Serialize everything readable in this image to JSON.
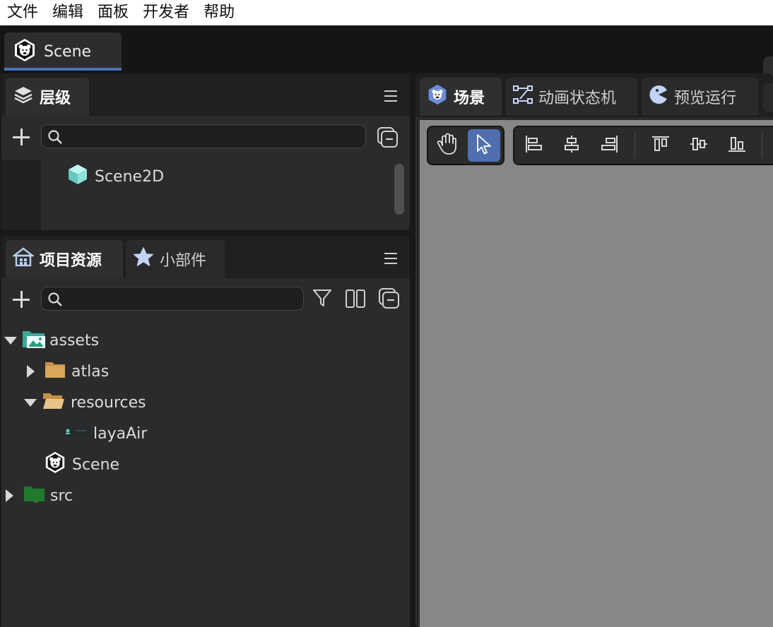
{
  "menubar": {
    "items": [
      "文件",
      "编辑",
      "面板",
      "开发者",
      "帮助"
    ]
  },
  "doc_tabs": [
    {
      "label": "Scene",
      "icon": "laya-scene-icon"
    }
  ],
  "hierarchy_panel": {
    "tab_label": "层级",
    "icon": "layers-icon",
    "search_placeholder": "",
    "items": [
      {
        "label": "Scene2D",
        "icon": "cube-icon"
      }
    ]
  },
  "project_panel": {
    "tabs": [
      {
        "label": "项目资源",
        "icon": "home-icon",
        "active": true
      },
      {
        "label": "小部件",
        "icon": "star-icon",
        "active": false
      }
    ],
    "search_placeholder": "",
    "tree": [
      {
        "label": "assets",
        "expanded": true,
        "icon": "assets-folder-icon"
      },
      {
        "label": "atlas",
        "expanded": false,
        "icon": "folder-icon"
      },
      {
        "label": "resources",
        "expanded": true,
        "icon": "folder-open-icon"
      },
      {
        "label": "layaAir",
        "icon": "image-thumbnail-icon"
      },
      {
        "label": "Scene",
        "icon": "laya-scene-icon"
      },
      {
        "label": "src",
        "expanded": false,
        "icon": "src-folder-icon"
      }
    ]
  },
  "scene_panel": {
    "tabs": [
      {
        "label": "场景",
        "icon": "laya-scene-icon",
        "active": true
      },
      {
        "label": "动画状态机",
        "icon": "state-machine-icon",
        "active": false
      },
      {
        "label": "预览运行",
        "icon": "preview-icon",
        "active": false
      }
    ],
    "tools": [
      "hand-tool-icon",
      "select-tool-icon"
    ],
    "align_tools": [
      "align-left-icon",
      "align-hcenter-icon",
      "align-right-icon",
      "align-top-icon",
      "align-vcenter-icon",
      "align-bottom-icon"
    ]
  },
  "colors": {
    "accent": "#4a73b5",
    "panel": "#2b2b2b",
    "viewport": "#878787",
    "menubar": "#ffffff"
  }
}
